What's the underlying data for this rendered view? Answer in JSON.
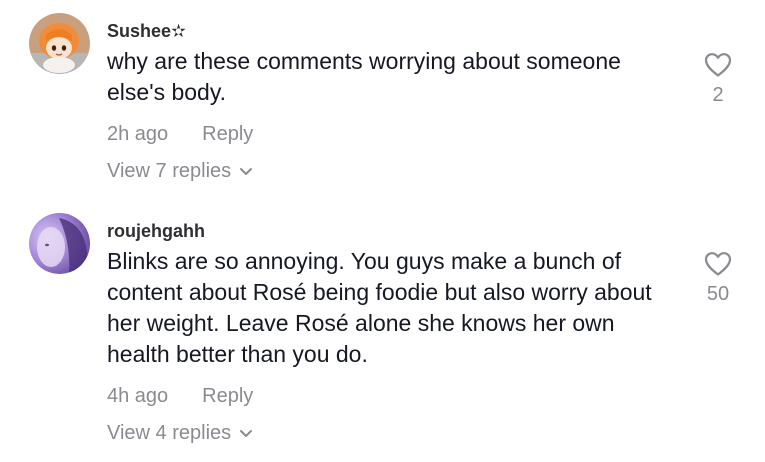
{
  "comments": [
    {
      "username": "Sushee✫",
      "text": "why are these comments worrying about someone else's body.",
      "time": "2h ago",
      "reply_label": "Reply",
      "view_replies": "View 7 replies",
      "like_count": "2",
      "avatar_icon": "anime-girl-avatar"
    },
    {
      "username": "roujehgahh",
      "text": "Blinks are so annoying. You guys make a bunch of content about Rosé being foodie but also worry about her weight. Leave Rosé alone she knows her own health better than you do.",
      "time": "4h ago",
      "reply_label": "Reply",
      "view_replies": "View 4 replies",
      "like_count": "50",
      "avatar_icon": "purple-portrait-avatar"
    }
  ],
  "colors": {
    "primary_text": "#161823",
    "secondary_text": "#8a8b91",
    "icon_stroke": "#8a8b91"
  }
}
